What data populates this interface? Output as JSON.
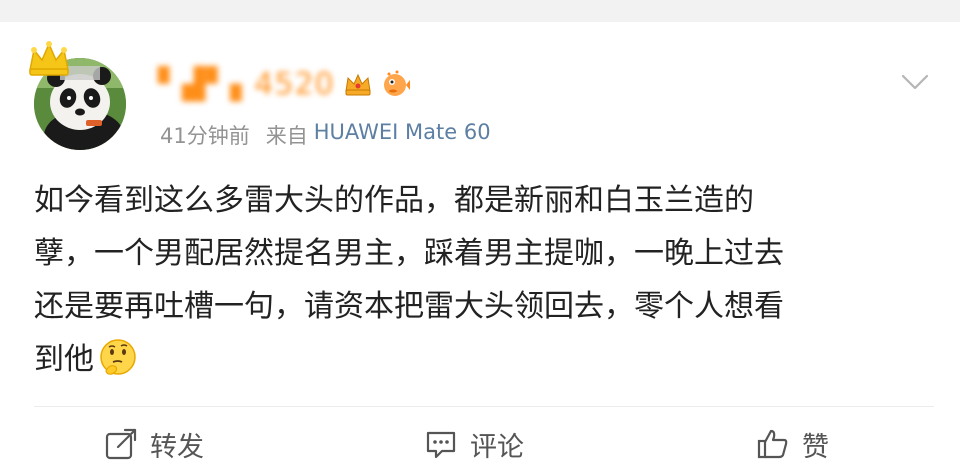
{
  "post": {
    "username": "▘▟▘▖4520",
    "time_ago": "41分钟前",
    "source_prefix": "来自",
    "source_device": "HUAWEI Mate 60",
    "content_lines": [
      "如今看到这么多雷大头的作品，都是新丽和白玉兰造的",
      "孽，一个男配居然提名男主，踩着男主提咖，一晚上过去",
      "还是要再吐槽一句，请资本把雷大头领回去，零个人想看",
      "到他"
    ],
    "emoji": "thinking-face"
  },
  "actions": {
    "repost_label": "转发",
    "comment_label": "评论",
    "like_label": "赞"
  },
  "colors": {
    "username": "#ff8200",
    "meta_gray": "#939393",
    "device_blue": "#5c7fa3",
    "text": "#222222"
  },
  "icons": {
    "crown": "crown-icon",
    "badge_crown": "vip-crown-badge-icon",
    "badge_fish": "pufferfish-badge-icon",
    "chevron": "chevron-down-icon",
    "repost": "repost-icon",
    "comment": "comment-icon",
    "like": "thumbs-up-icon"
  }
}
